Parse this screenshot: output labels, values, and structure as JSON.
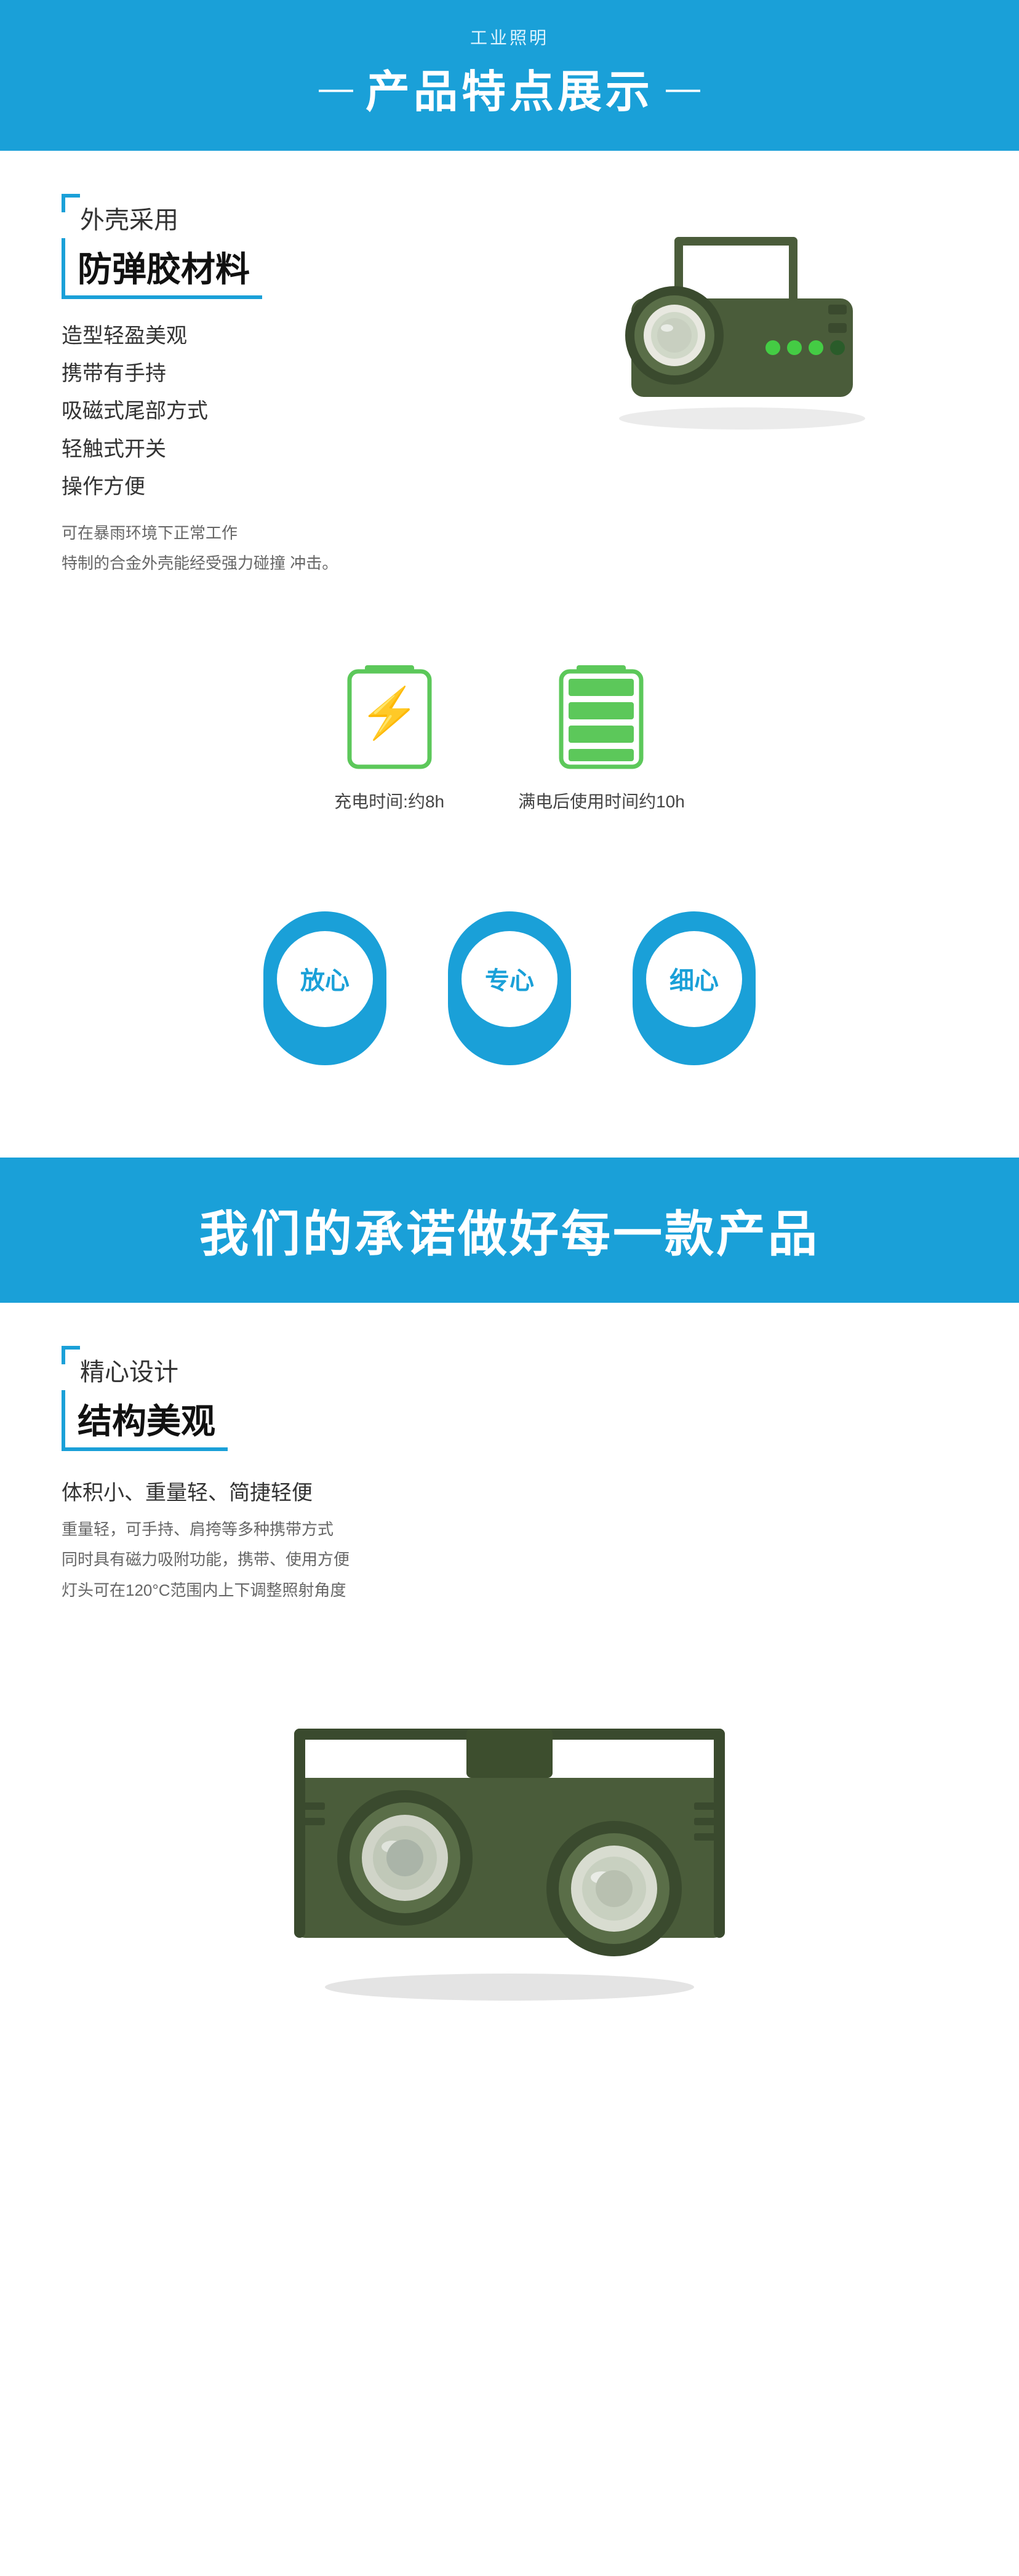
{
  "header": {
    "subtitle": "工业照明",
    "title": "产品特点展示",
    "bracket_left": "—",
    "bracket_right": "—"
  },
  "section1": {
    "label_top": "外壳采用",
    "label_main": "防弹胶材料",
    "features_main": [
      "造型轻盈美观",
      "携带有手持",
      "吸磁式尾部方式",
      "轻触式开关",
      "操作方便"
    ],
    "features_sub": [
      "可在暴雨环境下正常工作",
      "特制的合金外壳能经受强力碰撞 冲击。"
    ]
  },
  "battery": {
    "item1_label": "充电时间:约8h",
    "item2_label": "满电后使用时间约10h"
  },
  "trust": {
    "items": [
      "放心",
      "专心",
      "细心"
    ]
  },
  "promise": {
    "text": "我们的承诺做好每一款产品"
  },
  "section2": {
    "label_top": "精心设计",
    "label_main": "结构美观",
    "main_desc": "体积小、重量轻、简捷轻便",
    "sub_desc": [
      "重量轻，可手持、肩挎等多种携带方式",
      "同时具有磁力吸附功能，携带、使用方便",
      "灯头可在120°C范围内上下调整照射角度"
    ]
  }
}
